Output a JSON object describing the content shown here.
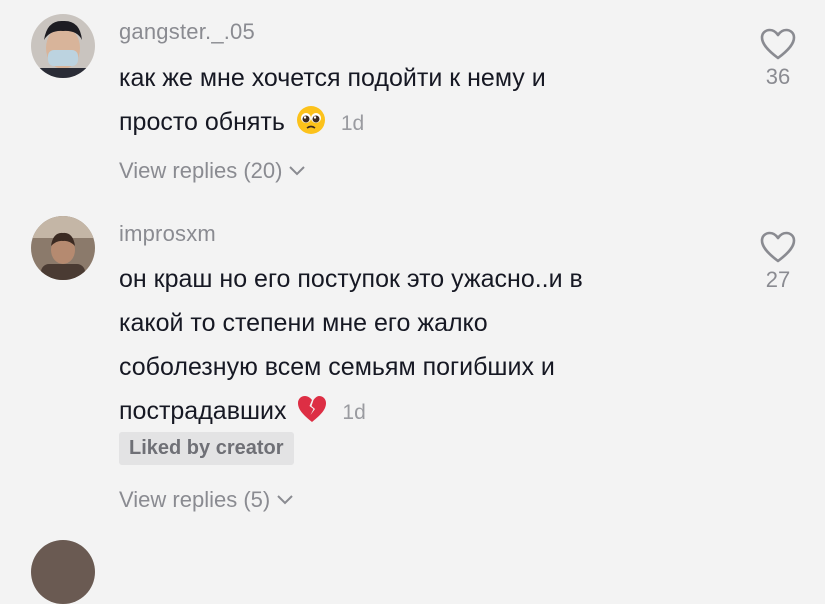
{
  "comments": [
    {
      "username": "gangster._.05",
      "text_line1": "как же мне хочется подойти к нему и",
      "text_line2": "просто обнять",
      "emoji": "pleading-face-emoji",
      "time": "1d",
      "likes": "36",
      "replies": "View replies (20)"
    },
    {
      "username": "improsxm",
      "text_line1": "он краш но его поступок это ужасно..и в",
      "text_line2": "какой то степени мне его жалко",
      "text_line3": "соболезную всем семьям погибших и",
      "text_line4": "пострадавших",
      "emoji": "broken-heart-emoji",
      "time": "1d",
      "likes": "27",
      "badge": "Liked by creator",
      "replies": "View replies (5)"
    }
  ],
  "colors": {
    "background": "#f3f3f3",
    "text": "#161823",
    "secondary": "#8a8b91",
    "badge_bg": "#e3e3e4"
  }
}
